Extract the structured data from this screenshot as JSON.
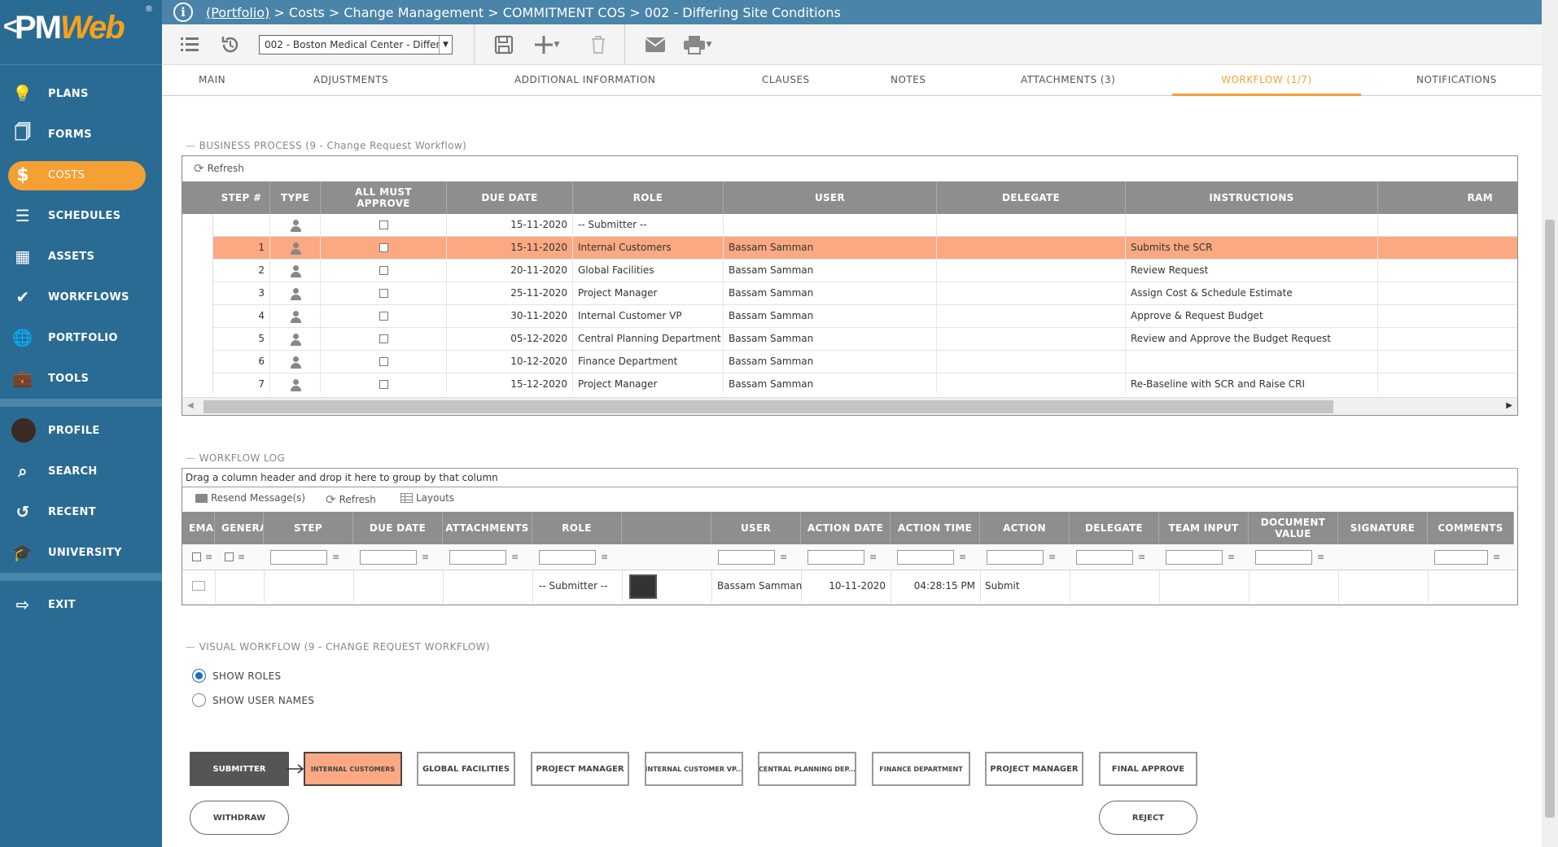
{
  "logo": {
    "chevron": "<",
    "text_a": "PM",
    "text_b": "Web",
    "reg": "®"
  },
  "sidebar": {
    "items": [
      {
        "label": "PLANS",
        "icon": "lightbulb-icon",
        "glyph": "💡"
      },
      {
        "label": "FORMS",
        "icon": "document-icon",
        "glyph": "🗍"
      },
      {
        "label": "COSTS",
        "icon": "dollar-icon",
        "glyph": "$"
      },
      {
        "label": "SCHEDULES",
        "icon": "bars-icon",
        "glyph": "☰"
      },
      {
        "label": "ASSETS",
        "icon": "building-icon",
        "glyph": "▦"
      },
      {
        "label": "WORKFLOWS",
        "icon": "check-icon",
        "glyph": "✔"
      },
      {
        "label": "PORTFOLIO",
        "icon": "globe-icon",
        "glyph": "🌐"
      },
      {
        "label": "TOOLS",
        "icon": "briefcase-icon",
        "glyph": "💼"
      }
    ],
    "items2": [
      {
        "label": "PROFILE",
        "icon": "avatar-icon",
        "glyph": "●"
      },
      {
        "label": "SEARCH",
        "icon": "search-icon",
        "glyph": "⌕"
      },
      {
        "label": "RECENT",
        "icon": "history-icon",
        "glyph": "↺"
      },
      {
        "label": "UNIVERSITY",
        "icon": "graduation-cap-icon",
        "glyph": "🎓"
      }
    ],
    "exit": {
      "label": "EXIT",
      "icon": "exit-icon",
      "glyph": "⇨"
    }
  },
  "breadcrumb": {
    "portfolio": "(Portfolio)",
    "rest": " > Costs > Change Management > COMMITMENT COS > 002 - Differing Site Conditions"
  },
  "toolbar": {
    "project_select": "002 - Boston Medical Center - Differ"
  },
  "tabs": [
    "MAIN",
    "ADJUSTMENTS",
    "ADDITIONAL INFORMATION",
    "CLAUSES",
    "NOTES",
    "ATTACHMENTS (3)",
    "WORKFLOW (1/7)",
    "NOTIFICATIONS"
  ],
  "business_process": {
    "title": "BUSINESS PROCESS (9 - Change Request Workflow)",
    "refresh": "Refresh",
    "columns": [
      "STEP #",
      "TYPE",
      "ALL MUST APPROVE",
      "DUE DATE",
      "ROLE",
      "USER",
      "DELEGATE",
      "INSTRUCTIONS",
      "RAM"
    ],
    "rows": [
      {
        "step": "",
        "due": "15-11-2020",
        "role": "-- Submitter --",
        "user": "",
        "instructions": ""
      },
      {
        "step": "1",
        "due": "15-11-2020",
        "role": "Internal Customers",
        "user": "Bassam Samman",
        "instructions": "Submits the SCR"
      },
      {
        "step": "2",
        "due": "20-11-2020",
        "role": "Global Facilities",
        "user": "Bassam Samman",
        "instructions": "Review Request"
      },
      {
        "step": "3",
        "due": "25-11-2020",
        "role": "Project Manager",
        "user": "Bassam Samman",
        "instructions": "Assign Cost & Schedule Estimate"
      },
      {
        "step": "4",
        "due": "30-11-2020",
        "role": "Internal Customer VP",
        "user": "Bassam Samman",
        "instructions": "Approve & Request Budget"
      },
      {
        "step": "5",
        "due": "05-12-2020",
        "role": "Central Planning Department",
        "user": "Bassam Samman",
        "instructions": "Review and Approve the Budget Request"
      },
      {
        "step": "6",
        "due": "10-12-2020",
        "role": "Finance Department",
        "user": "Bassam Samman",
        "instructions": ""
      },
      {
        "step": "7",
        "due": "15-12-2020",
        "role": "Project Manager",
        "user": "Bassam Samman",
        "instructions": "Re-Baseline with SCR and Raise CRI"
      }
    ],
    "selected_index": 1
  },
  "workflow_log": {
    "title": "WORKFLOW LOG",
    "group_hint": "Drag a column header and drop it here to group by that column",
    "tools": {
      "resend": "Resend Message(s)",
      "refresh": "Refresh",
      "layouts": "Layouts"
    },
    "columns": [
      "EMAIL",
      "GENERATE",
      "STEP",
      "DUE DATE",
      "ATTACHMENTS",
      "ROLE",
      "",
      "USER",
      "ACTION DATE",
      "ACTION TIME",
      "ACTION",
      "DELEGATE",
      "TEAM INPUT",
      "DOCUMENT VALUE",
      "SIGNATURE",
      "COMMENTS"
    ],
    "row": {
      "role": "-- Submitter --",
      "user": "Bassam Samman",
      "action_date": "10-11-2020",
      "action_time": "04:28:15 PM",
      "action": "Submit"
    }
  },
  "visual_workflow": {
    "title": "VISUAL WORKFLOW (9 - CHANGE REQUEST WORKFLOW)",
    "show_roles": "SHOW ROLES",
    "show_user_names": "SHOW USER NAMES",
    "nodes": [
      "SUBMITTER",
      "INTERNAL CUSTOMERS",
      "GLOBAL FACILITIES",
      "PROJECT MANAGER",
      "INTERNAL CUSTOMER VP...",
      "CENTRAL PLANNING DEP...",
      "FINANCE DEPARTMENT",
      "PROJECT MANAGER",
      "FINAL APPROVE"
    ],
    "withdraw": "WITHDRAW",
    "reject": "REJECT"
  },
  "colors": {
    "sidebar": "#2a6b94",
    "accent": "#f5a034",
    "selected_row": "#fba983",
    "header": "#8e8e8e"
  }
}
